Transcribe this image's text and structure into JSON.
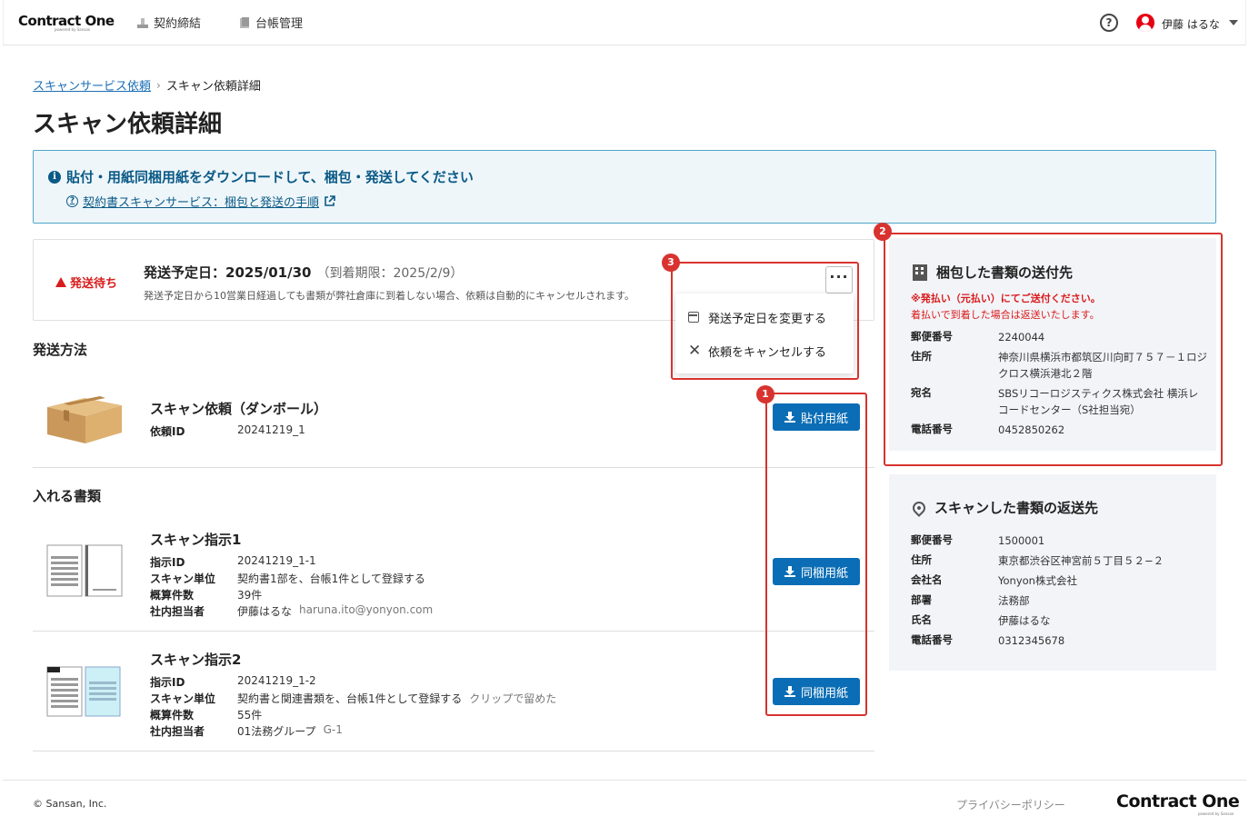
{
  "header": {
    "logo": "Contract One",
    "logo_sub": "powered by Sansan",
    "nav": [
      {
        "label": "契約締結",
        "icon": "sign-icon"
      },
      {
        "label": "台帳管理",
        "icon": "ledger-icon"
      }
    ],
    "help_icon": "?",
    "user_name": "伊藤 はるな"
  },
  "breadcrumb": {
    "parent": "スキャンサービス依頼",
    "separator": "›",
    "current": "スキャン依頼詳細"
  },
  "page_title": "スキャン依頼詳細",
  "banner": {
    "title": "貼付・用紙同梱用紙をダウンロードして、梱包・発送してください",
    "link": "契約書スキャンサービス：梱包と発送の手順",
    "info_glyph": "i"
  },
  "status": {
    "badge": "発送待ち",
    "ship_label": "発送予定日：2025/01/30",
    "deadline": "（到着期限：2025/2/9）",
    "note": "発送予定日から10営業日経過しても書類が弊社倉庫に到着しない場合、依頼は自動的にキャンセルされます。",
    "more": "···"
  },
  "menu": {
    "items": [
      {
        "label": "発送予定日を変更する",
        "icon": "calendar-icon"
      },
      {
        "label": "依頼をキャンセルする",
        "icon": "close-icon"
      }
    ],
    "close_glyph": "✕"
  },
  "annotations": [
    "1",
    "2",
    "3"
  ],
  "shipping": {
    "section_title": "発送方法",
    "item_title": "スキャン依頼（ダンボール）",
    "id_label": "依頼ID",
    "id_value": "20241219_1",
    "button": "貼付用紙"
  },
  "documents": {
    "section_title": "入れる書類",
    "items": [
      {
        "title": "スキャン指示1",
        "rows": [
          {
            "k": "指示ID",
            "v": "20241219_1-1",
            "x": ""
          },
          {
            "k": "スキャン単位",
            "v": "契約書1部を、台帳1件として登録する",
            "x": ""
          },
          {
            "k": "概算件数",
            "v": "39件",
            "x": ""
          },
          {
            "k": "社内担当者",
            "v": "伊藤はるな",
            "x": "haruna.ito@yonyon.com"
          }
        ],
        "button": "同梱用紙"
      },
      {
        "title": "スキャン指示2",
        "rows": [
          {
            "k": "指示ID",
            "v": "20241219_1-2",
            "x": ""
          },
          {
            "k": "スキャン単位",
            "v": "契約書と関連書類を、台帳1件として登録する",
            "x": "クリップで留めた"
          },
          {
            "k": "概算件数",
            "v": "55件",
            "x": ""
          },
          {
            "k": "社内担当者",
            "v": "01法務グループ",
            "x": "G-1"
          }
        ],
        "button": "同梱用紙"
      }
    ]
  },
  "send_to": {
    "title": "梱包した書類の送付先",
    "warn1": "※発払い（元払い）にてご送付ください。",
    "warn2": "着払いで到着した場合は返送いたします。",
    "rows": [
      {
        "k": "郵便番号",
        "v": "2240044"
      },
      {
        "k": "住所",
        "v": "神奈川県横浜市都筑区川向町７５７－１ロジクロス横浜港北２階"
      },
      {
        "k": "宛名",
        "v": "SBSリコーロジスティクス株式会社 横浜レコードセンター（S社担当宛）"
      },
      {
        "k": "電話番号",
        "v": "0452850262"
      }
    ]
  },
  "return_to": {
    "title": "スキャンした書類の返送先",
    "rows": [
      {
        "k": "郵便番号",
        "v": "1500001"
      },
      {
        "k": "住所",
        "v": "東京都渋谷区神宮前５丁目５２−２"
      },
      {
        "k": "会社名",
        "v": "Yonyon株式会社"
      },
      {
        "k": "部署",
        "v": "法務部"
      },
      {
        "k": "氏名",
        "v": "伊藤はるな"
      },
      {
        "k": "電話番号",
        "v": "0312345678"
      }
    ]
  },
  "footer": {
    "copyright": "© Sansan, Inc.",
    "privacy": "プライバシーポリシー",
    "logo": "Contract One",
    "logo_sub": "powered by Sansan"
  },
  "colors": {
    "primary": "#0a6db5",
    "danger": "#d81b1b",
    "annotation": "#d8332f",
    "banner_bg": "#eef6fa"
  }
}
